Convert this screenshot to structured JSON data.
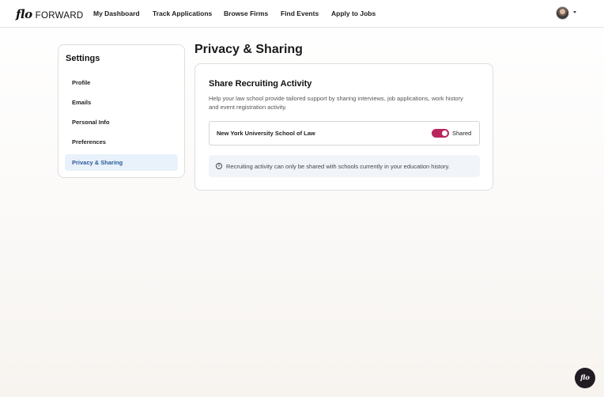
{
  "brand": {
    "mark": "flo",
    "name": "FORWARD"
  },
  "nav": {
    "items": [
      "My Dashboard",
      "Track Applications",
      "Browse Firms",
      "Find Events",
      "Apply to Jobs"
    ]
  },
  "settings": {
    "title": "Settings",
    "items": [
      "Profile",
      "Emails",
      "Personal Info",
      "Preferences",
      "Privacy & Sharing"
    ],
    "active": "Privacy & Sharing"
  },
  "page": {
    "title": "Privacy & Sharing"
  },
  "share": {
    "title": "Share Recruiting Activity",
    "description": "Help your law school provide tailored support by sharing interviews, job applications, work history and event registration activity.",
    "school": "New York University School of Law",
    "toggle_on": true,
    "toggle_label": "Shared",
    "info": "Recruiting activity can only be shared with schools currently in your education history."
  },
  "chat": {
    "label": "flo"
  },
  "colors": {
    "accent": "#b8265d",
    "active_bg": "#e9f1fb",
    "active_text": "#2a5c9a"
  },
  "icons": [
    "avatar",
    "chevron-down-icon",
    "info-icon",
    "chat-icon"
  ]
}
